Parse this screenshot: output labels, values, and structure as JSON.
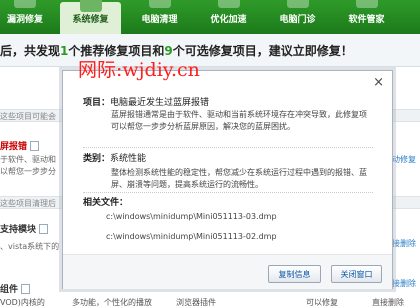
{
  "toolbar": {
    "items": [
      {
        "label": "漏洞修复",
        "icon": "shield-icon",
        "active": false
      },
      {
        "label": "系统修复",
        "icon": "wrench-icon",
        "active": true
      },
      {
        "label": "电脑清理",
        "icon": "broom-icon",
        "active": false
      },
      {
        "label": "优化加速",
        "icon": "rocket-icon",
        "active": false
      },
      {
        "label": "电脑门诊",
        "icon": "clinic-icon",
        "active": false
      },
      {
        "label": "软件管家",
        "icon": "package-icon",
        "active": false
      }
    ]
  },
  "headline": {
    "prefix": "后，共发现",
    "count_recommended": "1",
    "middle": "个推荐修复项目和",
    "count_optional": "9",
    "suffix": "个可选修复项目，建议立即修复！"
  },
  "background": {
    "row1": "这些项目可能会",
    "item1_title": "屏报错",
    "item1_line1": "于软件、驱动和",
    "item1_line2": "以帮您一步步分",
    "item1_right": "动修复",
    "row2": "这些项目清理后",
    "item2_title": "支持模块",
    "item2_line1": "、vista系统下的",
    "item2_right": "直接删除",
    "item3_title": "组件",
    "item3_right": "直接删除",
    "bottom_left": "VOD)内核的",
    "bottom_mid1": "多功能，个性化的播放",
    "bottom_mid2": "浏览器插件",
    "bottom_right1": "可以修复",
    "bottom_right2": "直接删除"
  },
  "dialog": {
    "close_glyph": "×",
    "item_label": "项目：",
    "item_value": "电脑最近发生过蓝屏报错",
    "item_desc": "蓝屏报错通常是由于软件、驱动和当前系统环境存在冲突导致，此修复项可以帮您一步步分析蓝屏原因，解决您的蓝屏困扰。",
    "category_label": "类别：",
    "category_value": "系统性能",
    "category_desc": "整体检测系统性能的稳定性，帮您减少在系统运行过程中遇到的报错、蓝屏、崩溃等问题，提高系统运行的流畅性。",
    "files_label": "相关文件：",
    "files": [
      "c:\\windows\\minidump\\Mini051113-03.dmp",
      "c:\\windows\\minidump\\Mini051113-02.dmp"
    ],
    "copy_button": "复制信息",
    "close_button": "关闭窗口"
  },
  "watermark": "网际:wjdiy.cn"
}
